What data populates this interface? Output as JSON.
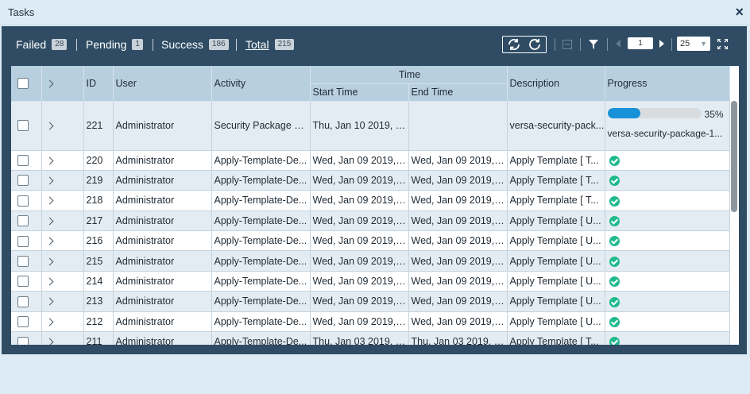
{
  "window": {
    "title": "Tasks",
    "close_label": "×"
  },
  "stats": {
    "failed": {
      "label": "Failed",
      "count": "28"
    },
    "pending": {
      "label": "Pending",
      "count": "1"
    },
    "success": {
      "label": "Success",
      "count": "186"
    },
    "total": {
      "label": "Total",
      "count": "215"
    }
  },
  "pagination": {
    "page": "1",
    "page_size": "25"
  },
  "icons": {
    "refresh": "refresh-icon",
    "auto_refresh": "auto-refresh-icon",
    "filter": "filter-icon",
    "expand": "expand-icon",
    "prev": "chevron-left-icon",
    "next": "chevron-right-icon"
  },
  "columns": {
    "id": "ID",
    "user": "User",
    "activity": "Activity",
    "time": "Time",
    "start_time": "Start Time",
    "end_time": "End Time",
    "description": "Description",
    "progress": "Progress"
  },
  "rows": [
    {
      "id": "221",
      "user": "Administrator",
      "activity": "Security Package D...",
      "start": "Thu, Jan 10 2019, 0...",
      "end": "",
      "description": "versa-security-pack...",
      "progress_pct": 35,
      "progress_label": "35%",
      "progress_sub": "versa-security-package-1..."
    },
    {
      "id": "220",
      "user": "Administrator",
      "activity": "Apply-Template-De...",
      "start": "Wed, Jan 09 2019, 2...",
      "end": "Wed, Jan 09 2019, 2...",
      "description": "Apply Template [ T..."
    },
    {
      "id": "219",
      "user": "Administrator",
      "activity": "Apply-Template-De...",
      "start": "Wed, Jan 09 2019, 2...",
      "end": "Wed, Jan 09 2019, 2...",
      "description": "Apply Template [ T..."
    },
    {
      "id": "218",
      "user": "Administrator",
      "activity": "Apply-Template-De...",
      "start": "Wed, Jan 09 2019, 1...",
      "end": "Wed, Jan 09 2019, 1...",
      "description": "Apply Template [ T..."
    },
    {
      "id": "217",
      "user": "Administrator",
      "activity": "Apply-Template-De...",
      "start": "Wed, Jan 09 2019, 0...",
      "end": "Wed, Jan 09 2019, 0...",
      "description": "Apply Template [ U..."
    },
    {
      "id": "216",
      "user": "Administrator",
      "activity": "Apply-Template-De...",
      "start": "Wed, Jan 09 2019, 0...",
      "end": "Wed, Jan 09 2019, 0...",
      "description": "Apply Template [ U..."
    },
    {
      "id": "215",
      "user": "Administrator",
      "activity": "Apply-Template-De...",
      "start": "Wed, Jan 09 2019, 0...",
      "end": "Wed, Jan 09 2019, 0...",
      "description": "Apply Template [ U..."
    },
    {
      "id": "214",
      "user": "Administrator",
      "activity": "Apply-Template-De...",
      "start": "Wed, Jan 09 2019, 0...",
      "end": "Wed, Jan 09 2019, 0...",
      "description": "Apply Template [ U..."
    },
    {
      "id": "213",
      "user": "Administrator",
      "activity": "Apply-Template-De...",
      "start": "Wed, Jan 09 2019, 0...",
      "end": "Wed, Jan 09 2019, 0...",
      "description": "Apply Template [ U..."
    },
    {
      "id": "212",
      "user": "Administrator",
      "activity": "Apply-Template-De...",
      "start": "Wed, Jan 09 2019, 0...",
      "end": "Wed, Jan 09 2019, 0...",
      "description": "Apply Template [ U..."
    },
    {
      "id": "211",
      "user": "Administrator",
      "activity": "Apply-Template-De...",
      "start": "Thu, Jan 03 2019, 2...",
      "end": "Thu, Jan 03 2019, 2...",
      "description": "Apply Template [ T..."
    }
  ],
  "colors": {
    "header_bg": "#2f4c64",
    "grid_header": "#b8cfe0",
    "success": "#1fb98e",
    "progress": "#1792d9"
  }
}
